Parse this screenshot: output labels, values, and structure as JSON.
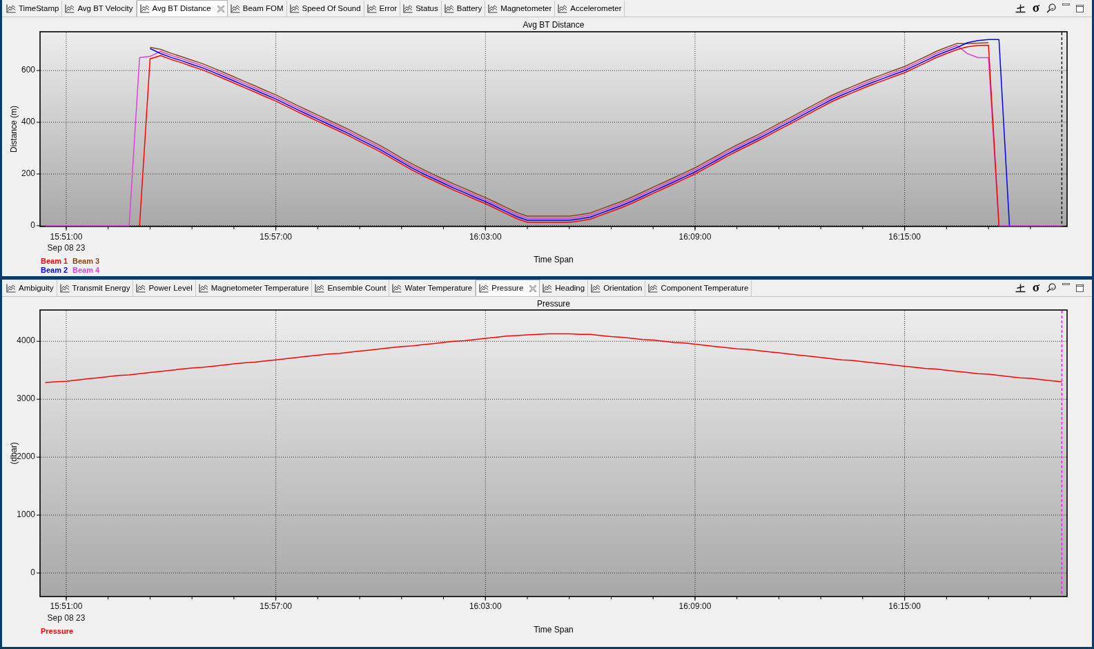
{
  "panels": [
    {
      "tabs": [
        {
          "label": "TimeStamp",
          "selected": false
        },
        {
          "label": "Avg BT Velocity",
          "selected": false
        },
        {
          "label": "Avg BT Distance",
          "selected": true
        },
        {
          "label": "Beam FOM",
          "selected": false
        },
        {
          "label": "Speed Of Sound",
          "selected": false
        },
        {
          "label": "Error",
          "selected": false
        },
        {
          "label": "Status",
          "selected": false
        },
        {
          "label": "Battery",
          "selected": false
        },
        {
          "label": "Magnetometer",
          "selected": false
        },
        {
          "label": "Accelerometer",
          "selected": false
        }
      ],
      "toolbar": [
        {
          "kind": "axis"
        },
        {
          "kind": "stats",
          "label": "σ"
        },
        {
          "kind": "find"
        },
        {
          "kind": "minimize"
        },
        {
          "kind": "maximize"
        }
      ],
      "chart": {
        "date_label": "Sep 08 23",
        "chart_data": {
          "type": "line",
          "title": "Avg BT Distance",
          "xlabel": "Time Span",
          "ylabel": "Distance (m)",
          "grid": true,
          "categories": [
            null,
            null,
            "15:51:00",
            null,
            null,
            null,
            null,
            null,
            null,
            null,
            null,
            null,
            null,
            null,
            null,
            null,
            null,
            null,
            null,
            null,
            null,
            null,
            "15:57:00",
            null,
            null,
            null,
            null,
            null,
            null,
            null,
            null,
            null,
            null,
            null,
            null,
            null,
            null,
            null,
            null,
            null,
            null,
            null,
            "16:03:00",
            null,
            null,
            null,
            null,
            null,
            null,
            null,
            null,
            null,
            null,
            null,
            null,
            null,
            null,
            null,
            null,
            null,
            null,
            null,
            "16:09:00",
            null,
            null,
            null,
            null,
            null,
            null,
            null,
            null,
            null,
            null,
            null,
            null,
            null,
            null,
            null,
            null,
            null,
            null,
            null,
            "16:15:00",
            null,
            null,
            null,
            null,
            null,
            null,
            null,
            null,
            null,
            null,
            null,
            null,
            null,
            null,
            null
          ],
          "series": [
            {
              "name": "Beam 1",
              "color": "#ff0000",
              "values": [
                null,
                null,
                null,
                null,
                null,
                null,
                null,
                null,
                null,
                0,
                645,
                658,
                643,
                630,
                616,
                603,
                586,
                569,
                552,
                534,
                517,
                499,
                482,
                462,
                442,
                423,
                404,
                385,
                366,
                347,
                326,
                306,
                285,
                262,
                238,
                215,
                194,
                175,
                156,
                137,
                120,
                102,
                85,
                66,
                46,
                27,
                13,
                13,
                13,
                13,
                13,
                18,
                25,
                40,
                55,
                70,
                87,
                106,
                125,
                143,
                162,
                181,
                200,
                222,
                244,
                267,
                288,
                308,
                328,
                349,
                371,
                392,
                414,
                436,
                457,
                479,
                497,
                514,
                531,
                547,
                562,
                577,
                592,
                611,
                630,
                650,
                666,
                681,
                692,
                697,
                698,
                0,
                null,
                null,
                null,
                null,
                null,
                null
              ]
            },
            {
              "name": "Beam 2",
              "color": "#0000ff",
              "values": [
                null,
                null,
                null,
                null,
                null,
                null,
                null,
                null,
                null,
                null,
                685,
                666,
                651,
                638,
                624,
                611,
                594,
                577,
                560,
                542,
                525,
                507,
                490,
                470,
                450,
                431,
                412,
                393,
                374,
                355,
                334,
                314,
                293,
                270,
                246,
                223,
                202,
                183,
                164,
                145,
                128,
                110,
                93,
                74,
                54,
                35,
                21,
                21,
                21,
                21,
                21,
                26,
                33,
                48,
                63,
                78,
                95,
                114,
                133,
                151,
                170,
                189,
                208,
                230,
                252,
                275,
                296,
                316,
                336,
                357,
                379,
                400,
                422,
                444,
                465,
                487,
                505,
                522,
                539,
                555,
                570,
                585,
                600,
                619,
                638,
                658,
                674,
                689,
                708,
                716,
                720,
                720,
                0,
                null,
                null,
                null,
                null,
                null
              ]
            },
            {
              "name": "Beam 3",
              "color": "#8b4513",
              "values": [
                null,
                null,
                null,
                null,
                null,
                null,
                null,
                null,
                null,
                null,
                690,
                682,
                667,
                654,
                640,
                627,
                610,
                593,
                576,
                558,
                541,
                523,
                506,
                486,
                466,
                447,
                428,
                409,
                390,
                371,
                350,
                330,
                309,
                286,
                262,
                239,
                218,
                199,
                180,
                161,
                144,
                126,
                109,
                90,
                70,
                51,
                37,
                37,
                37,
                37,
                37,
                42,
                49,
                64,
                79,
                94,
                111,
                130,
                149,
                167,
                186,
                205,
                224,
                246,
                268,
                291,
                312,
                332,
                352,
                373,
                395,
                416,
                438,
                460,
                481,
                503,
                521,
                538,
                555,
                571,
                586,
                601,
                616,
                635,
                654,
                674,
                690,
                705,
                704,
                706,
                708,
                null,
                null,
                null,
                null,
                null,
                null,
                null
              ]
            },
            {
              "name": "Beam 4",
              "color": "#e040d8",
              "values": [
                0,
                0,
                0,
                0,
                0,
                0,
                0,
                0,
                0,
                650,
                655,
                674,
                659,
                646,
                632,
                619,
                602,
                585,
                568,
                550,
                533,
                515,
                498,
                478,
                458,
                439,
                420,
                401,
                382,
                363,
                342,
                322,
                301,
                278,
                254,
                231,
                210,
                191,
                172,
                153,
                136,
                118,
                101,
                82,
                62,
                43,
                29,
                29,
                29,
                29,
                29,
                34,
                41,
                56,
                71,
                86,
                103,
                122,
                141,
                159,
                178,
                197,
                216,
                238,
                260,
                283,
                304,
                324,
                344,
                365,
                387,
                408,
                430,
                452,
                473,
                495,
                513,
                530,
                547,
                563,
                578,
                593,
                608,
                627,
                646,
                666,
                682,
                697,
                665,
                650,
                650,
                0,
                0,
                0,
                0,
                0,
                0,
                0
              ]
            }
          ],
          "ylim": [
            -3,
            750
          ],
          "yticks": [
            0,
            200,
            400,
            600
          ]
        }
      }
    },
    {
      "tabs": [
        {
          "label": "Ambiguity",
          "selected": false
        },
        {
          "label": "Transmit Energy",
          "selected": false
        },
        {
          "label": "Power Level",
          "selected": false
        },
        {
          "label": "Magnetometer Temperature",
          "selected": false
        },
        {
          "label": "Ensemble Count",
          "selected": false
        },
        {
          "label": "Water Temperature",
          "selected": false
        },
        {
          "label": "Pressure",
          "selected": true
        },
        {
          "label": "Heading",
          "selected": false
        },
        {
          "label": "Orientation",
          "selected": false
        },
        {
          "label": "Component Temperature",
          "selected": false
        }
      ],
      "toolbar": [
        {
          "kind": "axis"
        },
        {
          "kind": "stats",
          "label": "σ"
        },
        {
          "kind": "find"
        },
        {
          "kind": "minimize"
        },
        {
          "kind": "maximize"
        }
      ],
      "chart": {
        "date_label": "Sep 08 23",
        "chart_data": {
          "type": "line",
          "title": "Pressure",
          "xlabel": "Time Span",
          "ylabel": "(dbar)",
          "grid": true,
          "categories": [
            null,
            null,
            "15:51:00",
            null,
            null,
            null,
            null,
            null,
            null,
            null,
            null,
            null,
            null,
            null,
            null,
            null,
            null,
            null,
            null,
            null,
            null,
            null,
            "15:57:00",
            null,
            null,
            null,
            null,
            null,
            null,
            null,
            null,
            null,
            null,
            null,
            null,
            null,
            null,
            null,
            null,
            null,
            null,
            null,
            "16:03:00",
            null,
            null,
            null,
            null,
            null,
            null,
            null,
            null,
            null,
            null,
            null,
            null,
            null,
            null,
            null,
            null,
            null,
            null,
            null,
            "16:09:00",
            null,
            null,
            null,
            null,
            null,
            null,
            null,
            null,
            null,
            null,
            null,
            null,
            null,
            null,
            null,
            null,
            null,
            null,
            null,
            "16:15:00",
            null,
            null,
            null,
            null,
            null,
            null,
            null,
            null,
            null,
            null,
            null,
            null,
            null,
            null,
            null
          ],
          "series": [
            {
              "name": "Pressure",
              "color": "#ff0000",
              "values": [
                3290,
                3300,
                3310,
                3330,
                3350,
                3370,
                3390,
                3410,
                3420,
                3440,
                3460,
                3480,
                3500,
                3520,
                3540,
                3550,
                3570,
                3590,
                3610,
                3630,
                3640,
                3660,
                3680,
                3700,
                3720,
                3740,
                3760,
                3780,
                3790,
                3810,
                3830,
                3850,
                3870,
                3890,
                3910,
                3920,
                3940,
                3960,
                3980,
                4000,
                4010,
                4030,
                4050,
                4070,
                4090,
                4100,
                4110,
                4120,
                4130,
                4130,
                4130,
                4120,
                4120,
                4100,
                4080,
                4070,
                4050,
                4030,
                4020,
                4000,
                3980,
                3970,
                3950,
                3930,
                3910,
                3890,
                3870,
                3860,
                3840,
                3820,
                3800,
                3780,
                3760,
                3740,
                3720,
                3700,
                3680,
                3670,
                3650,
                3630,
                3610,
                3590,
                3570,
                3550,
                3530,
                3520,
                3500,
                3480,
                3460,
                3440,
                3430,
                3410,
                3390,
                3370,
                3360,
                3340,
                3320,
                3300
              ]
            }
          ],
          "ylim": [
            -406,
            4540
          ],
          "yticks": [
            0,
            1000,
            2000,
            3000,
            4000
          ]
        }
      }
    }
  ]
}
